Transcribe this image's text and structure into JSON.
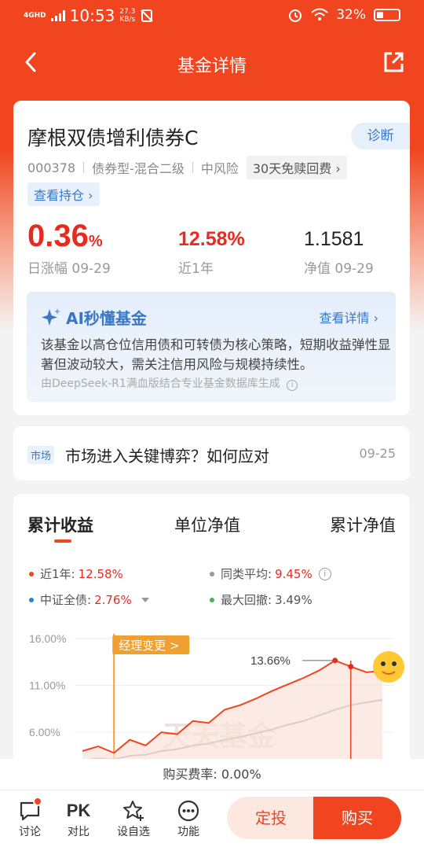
{
  "status": {
    "net_type": "4GHD",
    "time": "10:53",
    "speed_value": "27.3",
    "speed_unit": "KB/s",
    "battery": "32%"
  },
  "nav": {
    "title": "基金详情"
  },
  "fund": {
    "name": "摩根双债增利债券C",
    "diagnose_label": "诊断",
    "code": "000378",
    "category": "债券型-混合二级",
    "risk": "中风险",
    "fee_tag": "30天免赎回费",
    "holdings_label": "查看持仓",
    "daily_change_value": "0.36",
    "daily_change_unit": "%",
    "daily_change_label": "日涨幅 09-29",
    "year_return": "12.58%",
    "year_return_label": "近1年",
    "nav_value": "1.1581",
    "nav_label": "净值 09-29"
  },
  "ai": {
    "title": "AI秒懂基金",
    "more_label": "查看详情",
    "summary": "该基金以高仓位信用债和可转债为核心策略，短期收益弹性显著但波动较大，需关注信用风险与规模持续性。",
    "source": "由DeepSeek-R1满血版结合专业基金数据库生成"
  },
  "news": {
    "tag": "市场",
    "title": "市场进入关键博弈？如何应对",
    "date": "09-25"
  },
  "chart_tabs": [
    "累计收益",
    "单位净值",
    "累计净值"
  ],
  "legend": {
    "year_label": "近1年:",
    "year_value": "12.58%",
    "peer_label": "同类平均:",
    "peer_value": "9.45%",
    "index_label": "中证全债:",
    "index_value": "2.76%",
    "drawdown_label": "最大回撤:",
    "drawdown_value": "3.49%"
  },
  "chart_data": {
    "type": "line",
    "y_ticks": [
      "16.00%",
      "11.00%",
      "6.00%"
    ],
    "ylim": [
      4,
      17
    ],
    "annotation_manager": "经理变更 >",
    "annotation_peak": "13.66%",
    "watermark": "天天基金",
    "series": [
      {
        "name": "近1年",
        "color": "#f0451f",
        "values": [
          4.0,
          4.5,
          3.8,
          5.2,
          4.6,
          6.0,
          5.8,
          7.2,
          7.0,
          8.4,
          8.9,
          9.6,
          10.4,
          11.1,
          11.8,
          12.6,
          13.66,
          13.0,
          12.4,
          12.58
        ]
      },
      {
        "name": "同类平均",
        "color": "#999999",
        "values": [
          3.0,
          3.2,
          3.1,
          3.5,
          3.6,
          4.0,
          4.2,
          4.6,
          4.8,
          5.2,
          5.5,
          5.9,
          6.3,
          6.8,
          7.2,
          7.8,
          8.4,
          8.9,
          9.2,
          9.45
        ]
      }
    ]
  },
  "purchase_fee": "购买费率: 0.00%",
  "bottom_bar": {
    "discuss": "讨论",
    "compare_icon_text": "PK",
    "compare": "对比",
    "watchlist": "设自选",
    "functions": "功能",
    "sip": "定投",
    "buy": "购买"
  },
  "colors": {
    "brand": "#f0451f",
    "up": "#e82b20",
    "link": "#3a78c6"
  }
}
